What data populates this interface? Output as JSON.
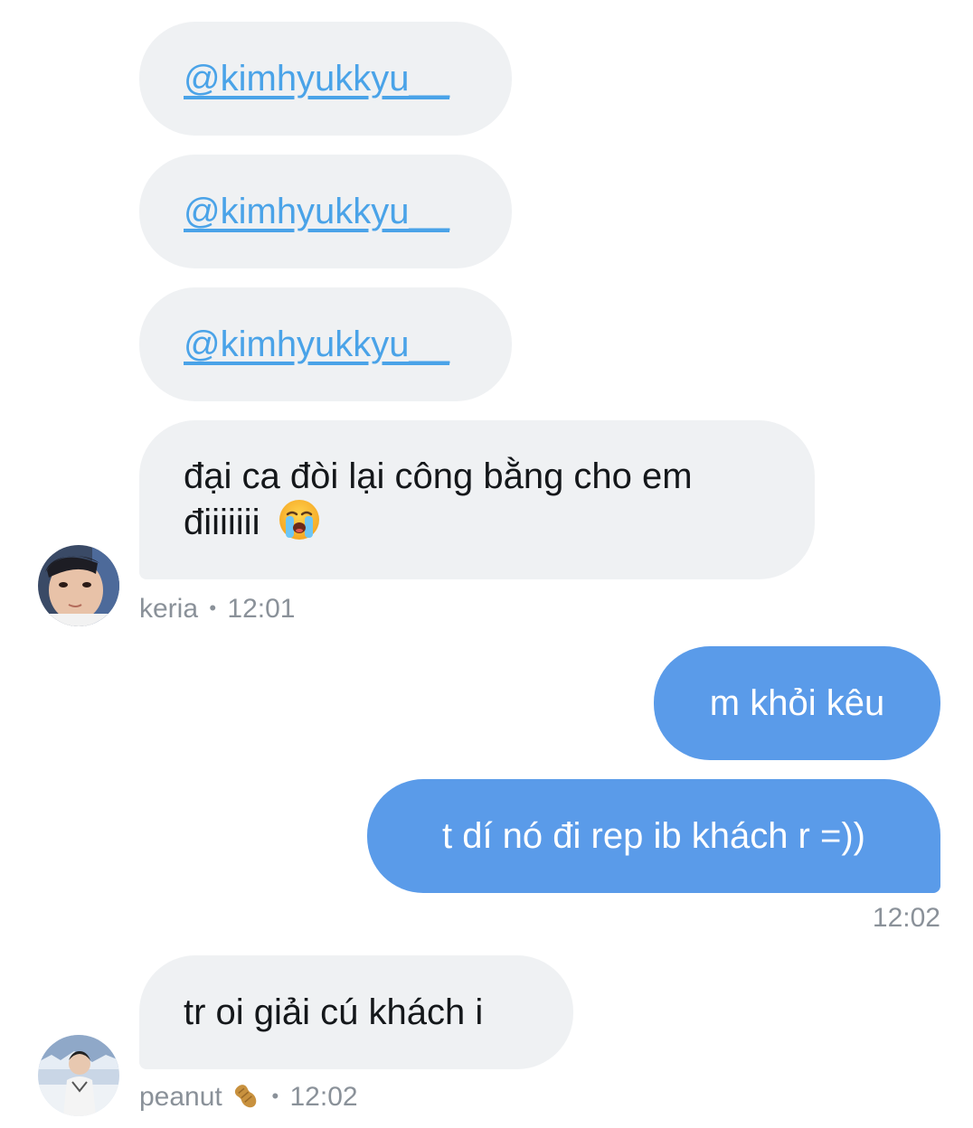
{
  "messages": {
    "m1": {
      "text": "@kimhyukkyu__"
    },
    "m2": {
      "text": "@kimhyukkyu__"
    },
    "m3": {
      "text": "@kimhyukkyu__"
    },
    "m4": {
      "line1": "đại ca đòi lại công bằng cho em",
      "line2": "điiiiiii",
      "emoji": "loudly-crying-face"
    },
    "meta1": {
      "name": "keria",
      "sep": "•",
      "time": "12:01"
    },
    "m5": {
      "text": "m khỏi kêu"
    },
    "m6": {
      "text": "t dí nó đi rep ib khách r =))"
    },
    "meta2": {
      "time": "12:02"
    },
    "m7": {
      "text": "tr oi giải cú khách i"
    },
    "meta3": {
      "name": "peanut",
      "emoji": "peanut-emoji",
      "sep": "•",
      "time": "12:02"
    }
  },
  "colors": {
    "incoming_bubble": "#eff1f3",
    "outgoing_bubble": "#5a9be9",
    "mention": "#4aa3e8",
    "meta_text": "#8a9199"
  }
}
